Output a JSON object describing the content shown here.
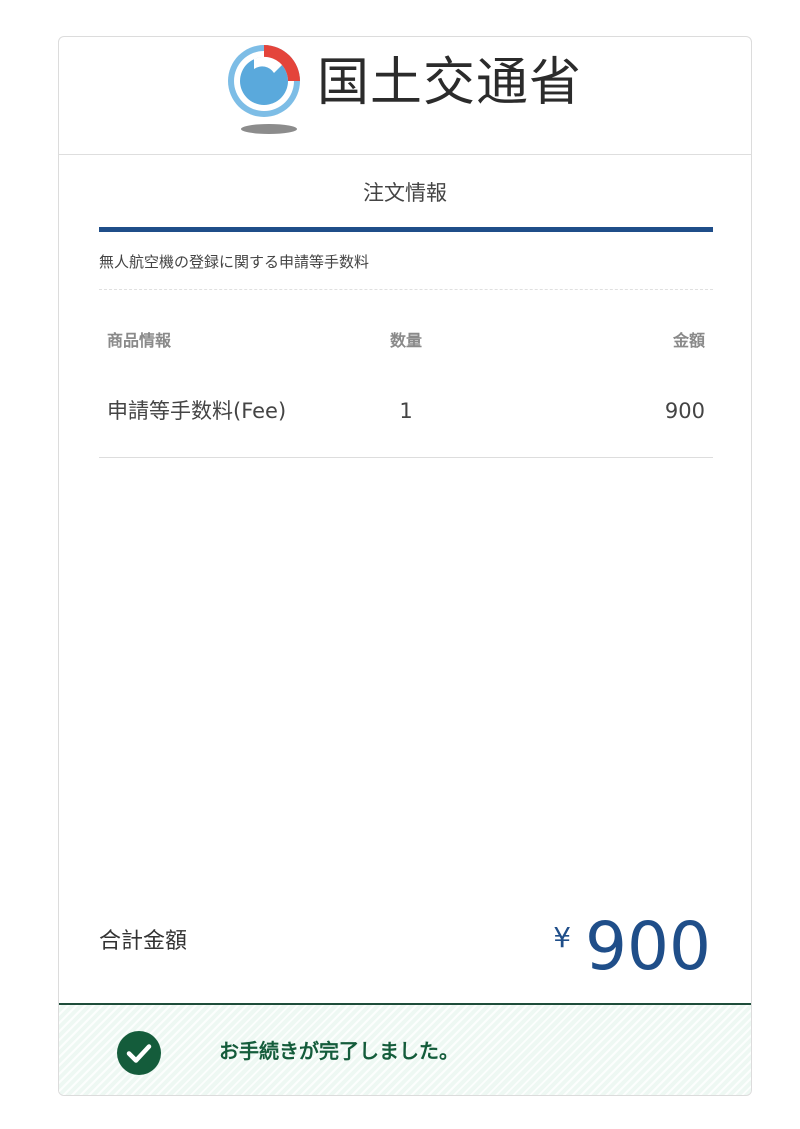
{
  "header": {
    "logo_text": "国土交通省"
  },
  "order": {
    "section_title": "注文情報",
    "description": "無人航空機の登録に関する申請等手数料",
    "columns": {
      "name": "商品情報",
      "quantity": "数量",
      "price": "金額"
    },
    "items": [
      {
        "name": "申請等手数料(Fee)",
        "quantity": "1",
        "price": "900"
      }
    ],
    "total_label": "合計金額",
    "total_currency": "¥",
    "total_value": "900"
  },
  "status": {
    "message": "お手続きが完了しました。",
    "icon": "check-circle-icon"
  },
  "colors": {
    "accent": "#1f4e89",
    "success": "#145c3b",
    "success_bg": "#eef8f3"
  }
}
